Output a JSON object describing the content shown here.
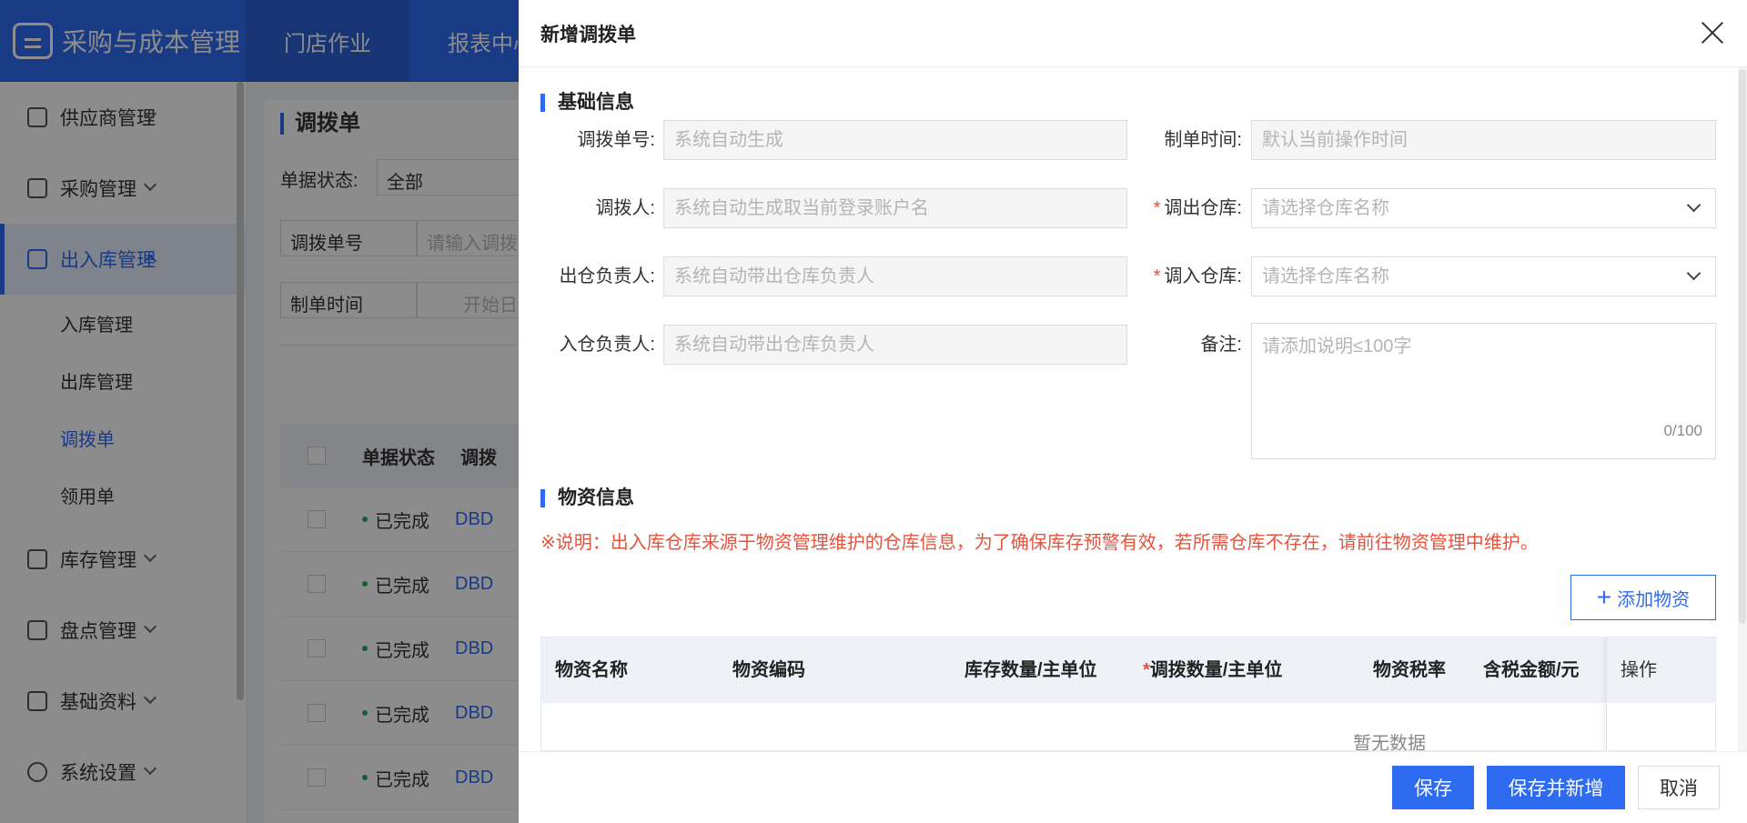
{
  "app": {
    "brand": "采购与成本管理",
    "topnav": [
      "门店作业",
      "报表中心"
    ]
  },
  "sidebar": {
    "items": [
      {
        "label": "供应商管理"
      },
      {
        "label": "采购管理"
      },
      {
        "label": "出入库管理"
      },
      {
        "label": "库存管理"
      },
      {
        "label": "盘点管理"
      },
      {
        "label": "基础资料"
      },
      {
        "label": "系统设置"
      }
    ],
    "sub_items": [
      "入库管理",
      "出库管理",
      "调拨单",
      "领用单"
    ]
  },
  "page": {
    "title": "调拨单",
    "status_label": "单据状态:",
    "status_value": "全部",
    "search_type": "调拨单号",
    "search_placeholder": "请输入调拨",
    "time_type": "制单时间",
    "date_placeholder": "开始日",
    "list_headers": [
      "单据状态",
      "调拨"
    ],
    "rows": [
      {
        "status": "已完成",
        "code": "DBD"
      },
      {
        "status": "已完成",
        "code": "DBD"
      },
      {
        "status": "已完成",
        "code": "DBD"
      },
      {
        "status": "已完成",
        "code": "DBD"
      },
      {
        "status": "已完成",
        "code": "DBD"
      }
    ]
  },
  "drawer": {
    "title": "新增调拨单",
    "basic_section": "基础信息",
    "fields": {
      "order_no": {
        "label": "调拨单号:",
        "placeholder": "系统自动生成"
      },
      "created_time": {
        "label": "制单时间:",
        "placeholder": "默认当前操作时间"
      },
      "operator": {
        "label": "调拨人:",
        "placeholder": "系统自动生成取当前登录账户名"
      },
      "out_warehouse": {
        "label": "调出仓库:",
        "placeholder": "请选择仓库名称"
      },
      "out_manager": {
        "label": "出仓负责人:",
        "placeholder": "系统自动带出仓库负责人"
      },
      "in_warehouse": {
        "label": "调入仓库:",
        "placeholder": "请选择仓库名称"
      },
      "in_manager": {
        "label": "入仓负责人:",
        "placeholder": "系统自动带出仓库负责人"
      },
      "remark": {
        "label": "备注:",
        "placeholder": "请添加说明≤100字",
        "counter": "0/100"
      }
    },
    "required_mark": "*",
    "materials_section": "物资信息",
    "notice": "※说明：出入库仓库来源于物资管理维护的仓库信息，为了确保库存预警有效，若所需仓库不存在，请前往物资管理中维护。",
    "add_button": "添加物资",
    "table": {
      "headers": {
        "name": "物资名称",
        "code": "物资编码",
        "stock": "库存数量/主单位",
        "transfer": "调拨数量/主单位",
        "tax_rate": "物资税率",
        "amount": "含税金额/元",
        "op": "操作"
      },
      "empty": "暂无数据"
    },
    "footer": {
      "save": "保存",
      "save_new": "保存并新增",
      "cancel": "取消"
    }
  },
  "colors": {
    "primary": "#2f6bf0",
    "danger": "#e5533d",
    "success": "#27ae60"
  }
}
